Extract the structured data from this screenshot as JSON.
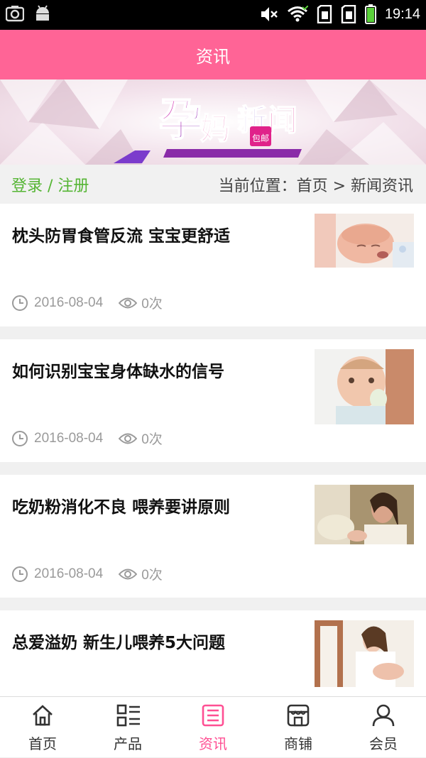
{
  "status_bar": {
    "time": "19:14",
    "icons": [
      "camera-icon",
      "android-icon",
      "mute-icon",
      "wifi-icon",
      "sim1-icon",
      "sim2-icon",
      "battery-icon"
    ]
  },
  "header": {
    "title": "资讯"
  },
  "banner": {
    "logo_text": "孕妈新闻",
    "logo_badge": "包邮",
    "colors": {
      "pink": "#e0228a",
      "purple": "#6a2fbf"
    }
  },
  "breadcrumb": {
    "login_label": "登录 / 注册",
    "location": "当前位置：首页 > 新闻资讯"
  },
  "articles": [
    {
      "title": "枕头防胃食管反流 宝宝更舒适",
      "date": "2016-08-04",
      "views": "0次",
      "thumb": "sleeping-baby"
    },
    {
      "title": "如何识别宝宝身体缺水的信号",
      "date": "2016-08-04",
      "views": "0次",
      "thumb": "baby-with-bottle"
    },
    {
      "title": "吃奶粉消化不良 喂养要讲原则",
      "date": "2016-08-04",
      "views": "0次",
      "thumb": "mother-feeding"
    },
    {
      "title": "总爱溢奶 新生儿喂养5大问题",
      "date": "",
      "views": "",
      "thumb": "mother-nursing"
    }
  ],
  "tabs": [
    {
      "label": "首页",
      "icon": "home-icon",
      "active": false
    },
    {
      "label": "产品",
      "icon": "products-icon",
      "active": false
    },
    {
      "label": "资讯",
      "icon": "news-icon",
      "active": true
    },
    {
      "label": "商铺",
      "icon": "shop-icon",
      "active": false
    },
    {
      "label": "会员",
      "icon": "member-icon",
      "active": false
    }
  ],
  "colors": {
    "accent": "#ff6496",
    "active_tab": "#ff4f93",
    "login_green": "#55b534"
  }
}
